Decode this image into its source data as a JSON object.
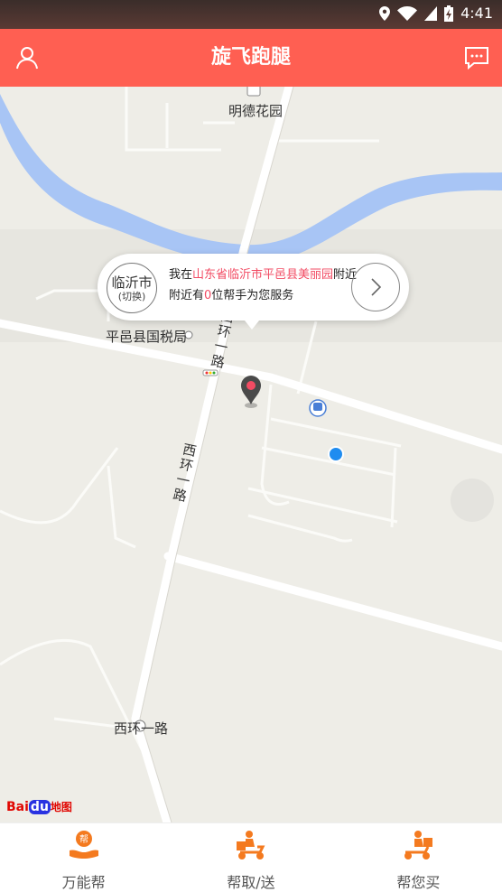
{
  "status_bar": {
    "time": "4:41"
  },
  "app": {
    "title": "旋飞跑腿"
  },
  "header": {
    "profile_icon": "user-icon",
    "message_icon": "message-icon"
  },
  "map": {
    "labels": {
      "garden": "明德花园",
      "tax_bureau": "平邑县国税局",
      "road_1": "西环一路",
      "road_2": "西环一路",
      "road_3": "西环一路"
    },
    "location_card": {
      "city": "临沂市",
      "switch_label": "(切换)",
      "line1_prefix": "我在",
      "line1_location": "山东省临沂市平邑县美丽园",
      "line1_suffix": "附近",
      "line2_prefix": "附近有",
      "line2_count": "0",
      "line2_suffix": "位帮手为您服务"
    },
    "logo": {
      "text_bai": "Bai",
      "text_du": "du",
      "text_map": "地图"
    }
  },
  "bottom_nav": {
    "items": [
      {
        "label": "万能帮",
        "icon": "helping-hand-icon"
      },
      {
        "label": "帮取/送",
        "icon": "delivery-scooter-icon"
      },
      {
        "label": "帮您买",
        "icon": "shopping-courier-icon"
      }
    ]
  },
  "colors": {
    "accent": "#ff5f52",
    "highlight": "#f24b63",
    "nav_icon": "#f47a1f",
    "river": "#a8c5f5",
    "map_bg": "#eeede7"
  }
}
